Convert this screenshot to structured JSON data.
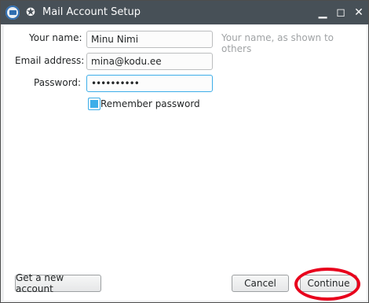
{
  "window": {
    "title": "Mail Account Setup",
    "icons": {
      "app": "thunderbird-icon",
      "menu": "window-menu-icon",
      "minimize": "minimize-icon",
      "maximize": "maximize-icon",
      "close": "close-icon"
    }
  },
  "form": {
    "name_label": "Your name:",
    "name_value": "Minu Nimi",
    "name_hint": "Your name, as shown to others",
    "email_label": "Email address:",
    "email_value": "mina@kodu.ee",
    "password_label": "Password:",
    "password_value": "••••••••••",
    "remember_label": "Remember password",
    "remember_checked": true
  },
  "buttons": {
    "get_account": "Get a new account",
    "cancel": "Cancel",
    "continue": "Continue"
  },
  "colors": {
    "accent": "#3daee9",
    "titlebar": "#475057",
    "highlight": "#e8001c"
  }
}
